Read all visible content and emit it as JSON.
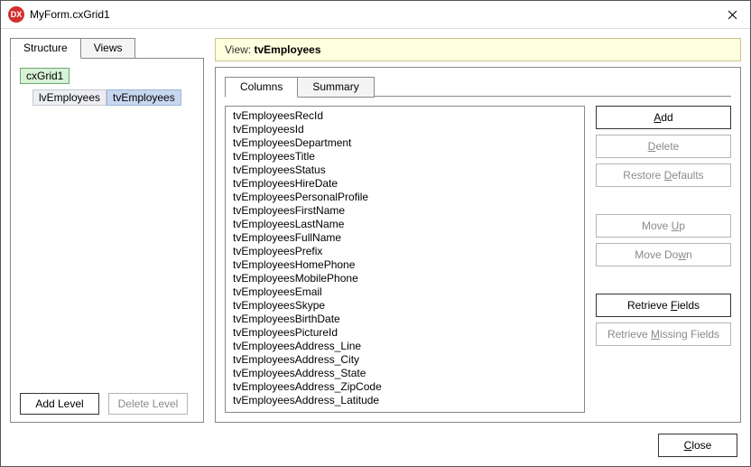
{
  "window": {
    "icon_text": "DX",
    "title": "MyForm.cxGrid1"
  },
  "leftTabs": {
    "structure": "Structure",
    "views": "Views"
  },
  "tree": {
    "root": "cxGrid1",
    "items": [
      {
        "label": "lvEmployees",
        "selected": false
      },
      {
        "label": "tvEmployees",
        "selected": true
      }
    ]
  },
  "leftButtons": {
    "addLevel": "Add Level",
    "deleteLevel": "Delete Level"
  },
  "viewHeader": {
    "label": "View:",
    "value": "tvEmployees"
  },
  "rightTabs": {
    "columns": "Columns",
    "summary": "Summary"
  },
  "columns": [
    "tvEmployeesRecId",
    "tvEmployeesId",
    "tvEmployeesDepartment",
    "tvEmployeesTitle",
    "tvEmployeesStatus",
    "tvEmployeesHireDate",
    "tvEmployeesPersonalProfile",
    "tvEmployeesFirstName",
    "tvEmployeesLastName",
    "tvEmployeesFullName",
    "tvEmployeesPrefix",
    "tvEmployeesHomePhone",
    "tvEmployeesMobilePhone",
    "tvEmployeesEmail",
    "tvEmployeesSkype",
    "tvEmployeesBirthDate",
    "tvEmployeesPictureId",
    "tvEmployeesAddress_Line",
    "tvEmployeesAddress_City",
    "tvEmployeesAddress_State",
    "tvEmployeesAddress_ZipCode",
    "tvEmployeesAddress_Latitude"
  ],
  "sideButtons": {
    "add": "Add",
    "delete": "Delete",
    "restoreDefaults": "Restore Defaults",
    "moveUp": "Move Up",
    "moveDown": "Move Down",
    "retrieveFields": "Retrieve Fields",
    "retrieveMissing": "Retrieve Missing Fields"
  },
  "footer": {
    "close": "Close"
  },
  "mnemonics": {
    "add_u": "A",
    "delete_u": "D",
    "restore_u": "D",
    "moveUp_u": "U",
    "moveDown_u": "w",
    "retrieve_u": "F",
    "retrieveMissing_u": "M",
    "close_u": "C"
  }
}
